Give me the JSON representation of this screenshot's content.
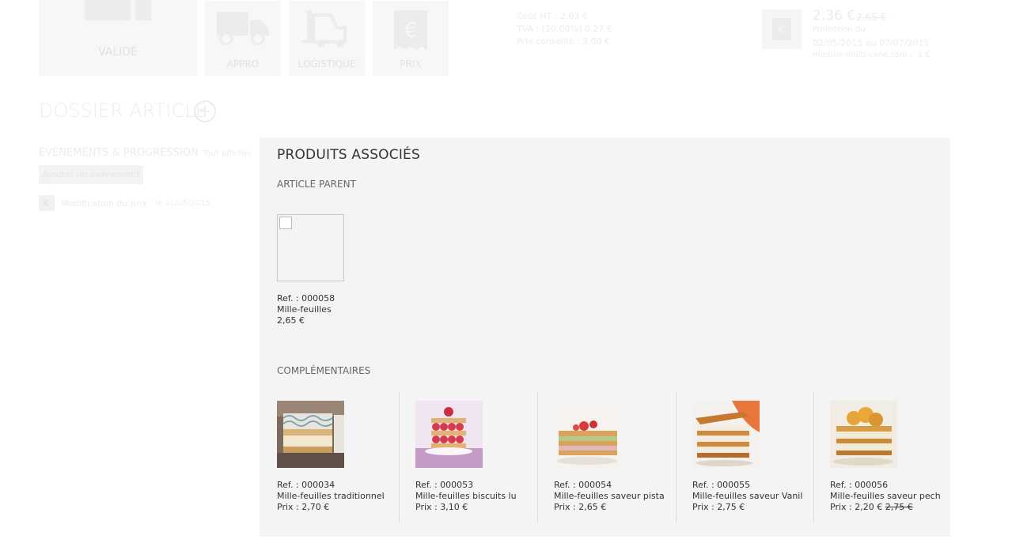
{
  "tiles": [
    {
      "label": "VALIDÉ",
      "icon": "windows-icon"
    },
    {
      "label": "APPRO",
      "icon": "truck-icon"
    },
    {
      "label": "LOGISTIQUE",
      "icon": "forklift-icon"
    },
    {
      "label": "PRIX",
      "icon": "euro-receipt-icon"
    }
  ],
  "pricing": {
    "line1": "Coût HT : 2,63 €",
    "line2": "TVA : (10,00%) 0,27 €",
    "line3": "Prix conseillé : 3,00 €"
  },
  "promo": {
    "price": "2,36 €",
    "old_price": "2,65 €",
    "label": "Promotion du",
    "dates": "02/05/2015 au 07/07/2015",
    "note": "mission-multi-cane.com : -1 €"
  },
  "dossier": {
    "title": "DOSSIER ARTICLE",
    "add": "+"
  },
  "events": {
    "title": "ÉVÉNEMENTS & PROGRESSION",
    "link": "Tout afficher",
    "add_button": "Ajouter un événement",
    "item_icon": "€",
    "item_text": "Modification du prix",
    "item_date": "le 01/05/2015"
  },
  "panel": {
    "title": "PRODUITS ASSOCIÉS",
    "parent_section": "ARTICLE PARENT",
    "parent": {
      "ref": "Ref. : 000058",
      "name": "Mille-feuilles",
      "price": "2,65 €"
    },
    "complementary_section": "COMPLÉMENTAIRES",
    "complementary": [
      {
        "ref": "Ref. : 000034",
        "name": "Mille-feuilles traditionnel",
        "price": "Prix : 2,70 €",
        "old_price": ""
      },
      {
        "ref": "Ref. : 000053",
        "name": "Mille-feuilles biscuits lu",
        "price": "Prix : 3,10 €",
        "old_price": ""
      },
      {
        "ref": "Ref. : 000054",
        "name": "Mille-feuilles saveur pista…",
        "price": "Prix : 2,65 €",
        "old_price": ""
      },
      {
        "ref": "Ref. : 000055",
        "name": "Mille-feuilles saveur Vanille",
        "price": "Prix : 2,75 €",
        "old_price": ""
      },
      {
        "ref": "Ref. : 000056",
        "name": "Mille-feuilles saveur pech…",
        "price": "Prix : 2,20 €",
        "old_price": "2,75 €"
      }
    ]
  }
}
